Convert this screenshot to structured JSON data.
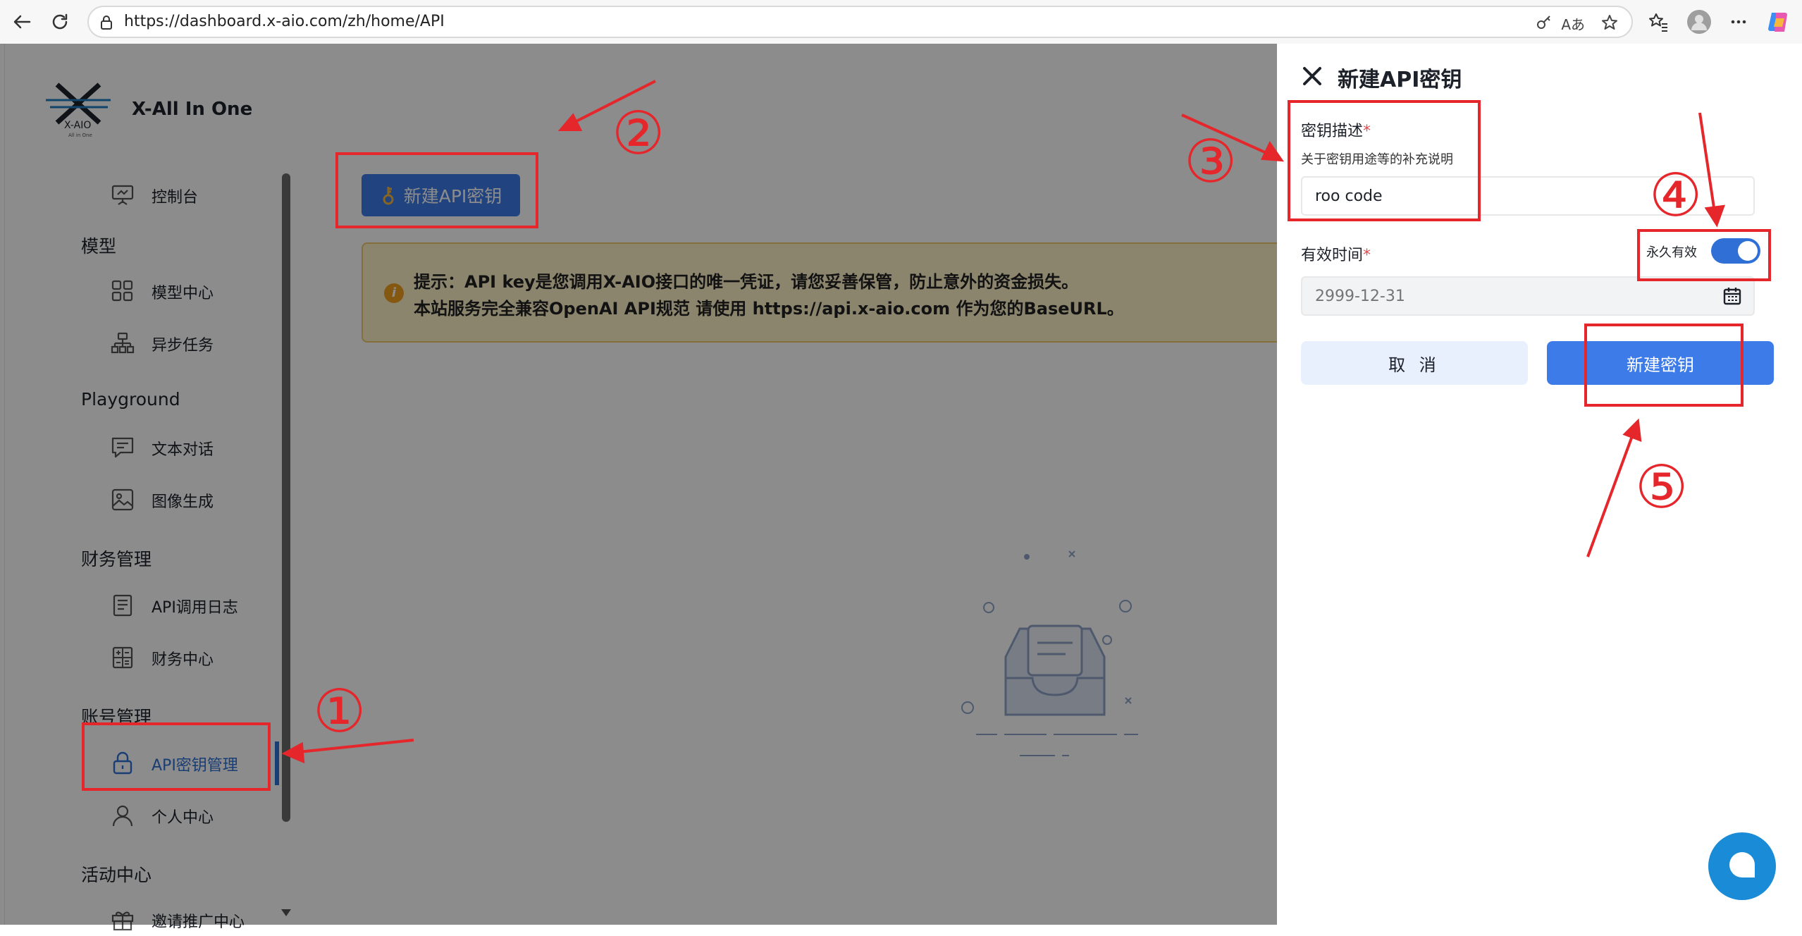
{
  "browser": {
    "url": "https://dashboard.x-aio.com/zh/home/API"
  },
  "sidebar": {
    "app_name": "X-All In One",
    "logo_text": "X-AIO",
    "logo_sub": "All in One",
    "items": [
      {
        "label": "控制台"
      },
      {
        "group": "模型"
      },
      {
        "label": "模型中心"
      },
      {
        "label": "异步任务"
      },
      {
        "group": "Playground"
      },
      {
        "label": "文本对话"
      },
      {
        "label": "图像生成"
      },
      {
        "group": "财务管理"
      },
      {
        "label": "API调用日志"
      },
      {
        "label": "财务中心"
      },
      {
        "group": "账号管理"
      },
      {
        "label": "API密钥管理",
        "active": true
      },
      {
        "label": "个人中心"
      },
      {
        "group": "活动中心"
      },
      {
        "label": "邀请推广中心"
      }
    ]
  },
  "main": {
    "new_key_button": "新建API密钥",
    "notice_line1": "提示：API key是您调用X-AIO接口的唯一凭证，请您妥善保管，防止意外的资金损失。",
    "notice_line2": "本站服务完全兼容OpenAI API规范 请使用 https://api.x-aio.com 作为您的BaseURL。"
  },
  "drawer": {
    "title": "新建API密钥",
    "desc_label": "密钥描述",
    "desc_help": "关于密钥用途等的补充说明",
    "desc_value": "roo code",
    "expiry_label": "有效时间",
    "permanent_label": "永久有效",
    "permanent_on": true,
    "date_placeholder": "2999-12-31",
    "cancel_label": "取 消",
    "create_label": "新建密钥"
  },
  "annotations": {
    "markers": [
      "①",
      "②",
      "③",
      "④",
      "⑤"
    ],
    "color": "#e5262b"
  },
  "colors": {
    "primary": "#3c7be8",
    "notice_bg": "#fff2c8",
    "active_menu": "#2f6fd6"
  }
}
